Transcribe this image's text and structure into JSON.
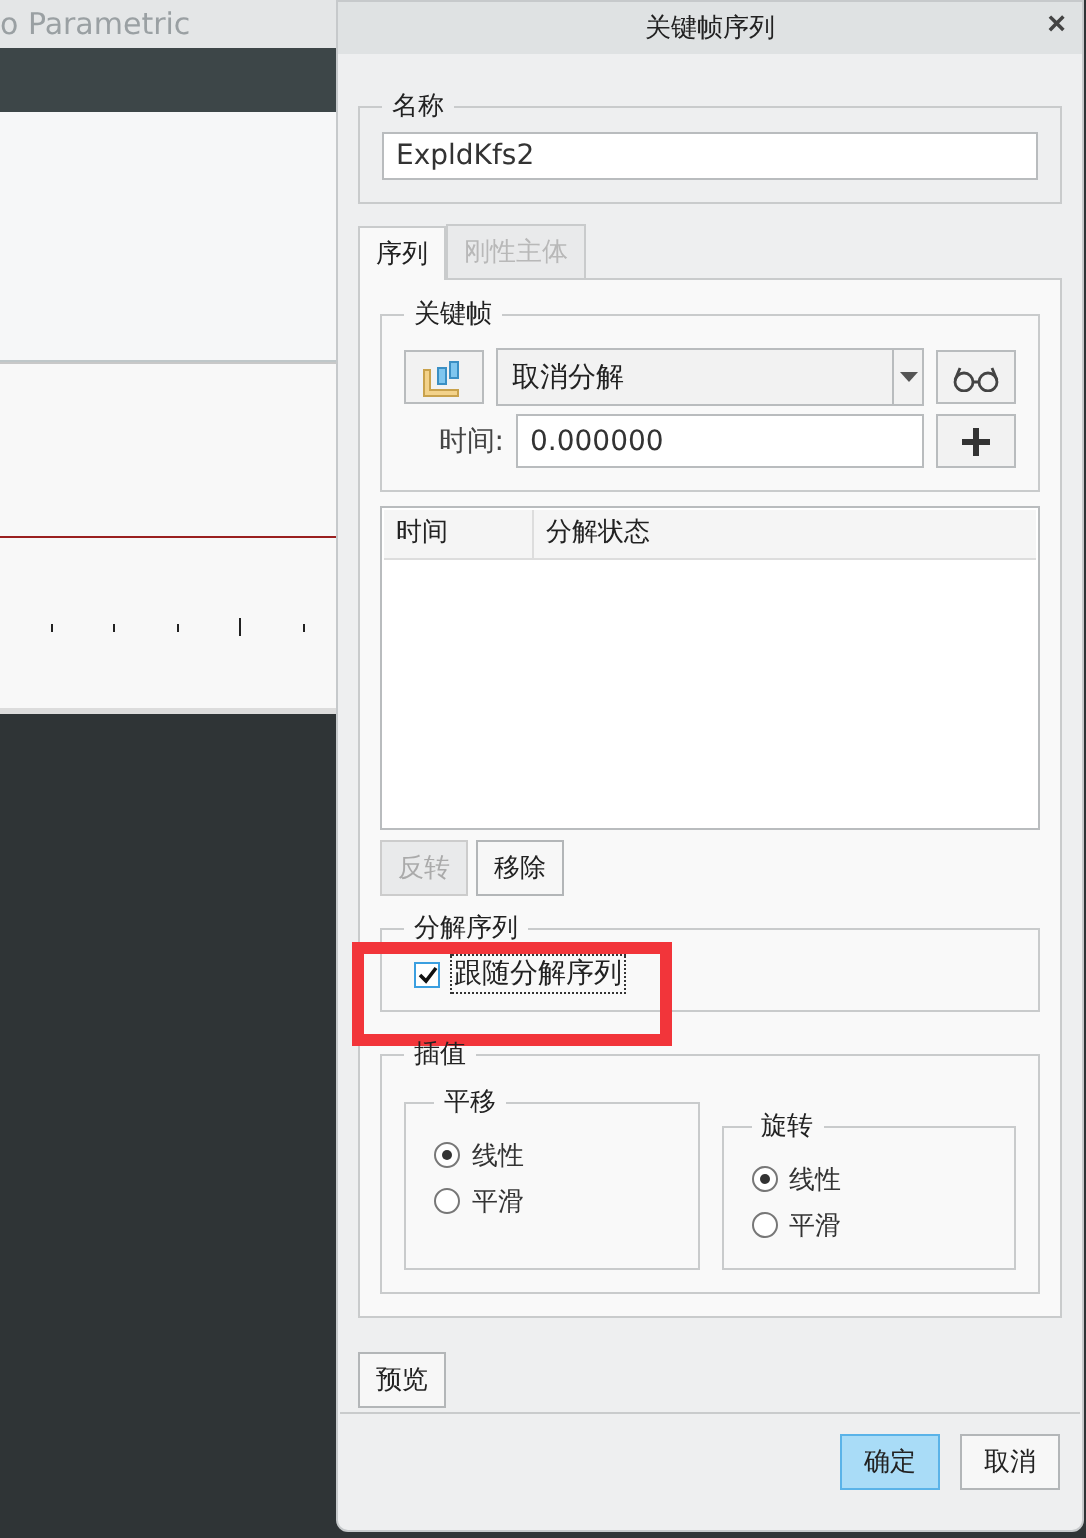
{
  "background_window": {
    "title": "o Parametric"
  },
  "dialog": {
    "title": "关键帧序列",
    "close": "×",
    "name_group": {
      "label": "名称",
      "value": "ExpldKfs2"
    },
    "tabs": [
      {
        "label": "序列",
        "selected": true,
        "disabled": false
      },
      {
        "label": "刚性主体",
        "selected": false,
        "disabled": true
      }
    ],
    "keyframe_group": {
      "label": "关键帧",
      "dropdown_value": "取消分解",
      "time_label": "时间:",
      "time_value": "0.000000"
    },
    "table": {
      "columns": [
        "时间",
        "分解状态"
      ]
    },
    "table_buttons": [
      {
        "label": "反转",
        "disabled": true
      },
      {
        "label": "移除",
        "disabled": false
      }
    ],
    "sequence_group": {
      "label": "分解序列",
      "checkbox": {
        "label": "跟随分解序列",
        "checked": true,
        "highlighted": true
      }
    },
    "interpolation": {
      "label": "插值",
      "groups": [
        {
          "label": "平移",
          "options": [
            {
              "label": "线性",
              "selected": true
            },
            {
              "label": "平滑",
              "selected": false
            }
          ]
        },
        {
          "label": "旋转",
          "options": [
            {
              "label": "线性",
              "selected": true
            },
            {
              "label": "平滑",
              "selected": false
            }
          ]
        }
      ]
    },
    "preview_button": "预览",
    "footer_buttons": [
      {
        "label": "确定",
        "default": true
      },
      {
        "label": "取消",
        "default": false
      }
    ]
  }
}
